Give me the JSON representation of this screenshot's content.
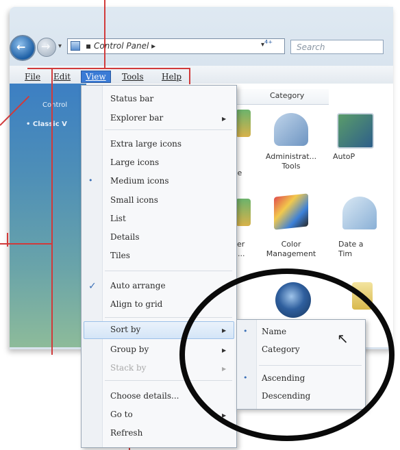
{
  "toolbar": {
    "address_path": "▪ Control Panel ▸",
    "search_placeholder": "Search",
    "dropdown_glyph": "▾",
    "refresh_glyph": "⁴⁺"
  },
  "menubar": {
    "items": [
      {
        "label": "File"
      },
      {
        "label": "Edit"
      },
      {
        "label": "View"
      },
      {
        "label": "Tools"
      },
      {
        "label": "Help"
      }
    ]
  },
  "left_pane": {
    "items": [
      {
        "label": "Control"
      },
      {
        "label": "• Classic V"
      }
    ]
  },
  "content": {
    "column_header": "Category",
    "icons": [
      {
        "label": "Administrat...\nTools",
        "color_a": "#bfd4ea",
        "color_b": "#6e95c2",
        "icon": "admin-tools-icon"
      },
      {
        "label": "AutoP",
        "color_a": "#5a9c6a",
        "color_b": "#2e5f8a",
        "icon": "autoplay-icon"
      },
      {
        "label": "Color\nManagement",
        "color_a": "#e04d4d",
        "color_b": "#3c80d8",
        "icon": "color-management-icon"
      },
      {
        "label": "Date a\nTim",
        "color_a": "#d9e8f4",
        "color_b": "#8ab0d6",
        "icon": "date-time-icon"
      },
      {
        "label": "",
        "color_a": "#2f5f9e",
        "color_b": "#17365e",
        "icon": "globe-icon"
      }
    ],
    "partial_labels": [
      {
        "label": "ve"
      },
      {
        "label": "ker\nn..."
      }
    ]
  },
  "view_menu": {
    "items": [
      {
        "label": "Status bar",
        "mark": "",
        "sub": false,
        "disabled": false
      },
      {
        "label": "Explorer bar",
        "mark": "",
        "sub": true,
        "disabled": false
      },
      {
        "label": "Extra large icons",
        "mark": "",
        "sub": false,
        "disabled": false
      },
      {
        "label": "Large icons",
        "mark": "",
        "sub": false,
        "disabled": false
      },
      {
        "label": "Medium icons",
        "mark": "•",
        "sub": false,
        "disabled": false
      },
      {
        "label": "Small icons",
        "mark": "",
        "sub": false,
        "disabled": false
      },
      {
        "label": "List",
        "mark": "",
        "sub": false,
        "disabled": false
      },
      {
        "label": "Details",
        "mark": "",
        "sub": false,
        "disabled": false
      },
      {
        "label": "Tiles",
        "mark": "",
        "sub": false,
        "disabled": false
      },
      {
        "label": "Auto arrange",
        "mark": "✓",
        "sub": false,
        "disabled": false
      },
      {
        "label": "Align to grid",
        "mark": "",
        "sub": false,
        "disabled": false
      },
      {
        "label": "Sort by",
        "mark": "",
        "sub": true,
        "disabled": false
      },
      {
        "label": "Group by",
        "mark": "",
        "sub": true,
        "disabled": false
      },
      {
        "label": "Stack by",
        "mark": "",
        "sub": true,
        "disabled": true
      },
      {
        "label": "Choose details...",
        "mark": "",
        "sub": false,
        "disabled": false
      },
      {
        "label": "Go to",
        "mark": "",
        "sub": true,
        "disabled": false
      },
      {
        "label": "Refresh",
        "mark": "",
        "sub": false,
        "disabled": false
      }
    ],
    "submenu_glyph": "▶"
  },
  "sort_menu": {
    "items": [
      {
        "label": "Name",
        "mark": "•"
      },
      {
        "label": "Category",
        "mark": ""
      },
      {
        "label": "Ascending",
        "mark": "•"
      },
      {
        "label": "Descending",
        "mark": ""
      }
    ]
  },
  "colors": {
    "annotation": "#d13a3a",
    "highlight_circle": "#0a0a0a",
    "menu_active": "#3a7bd5"
  }
}
